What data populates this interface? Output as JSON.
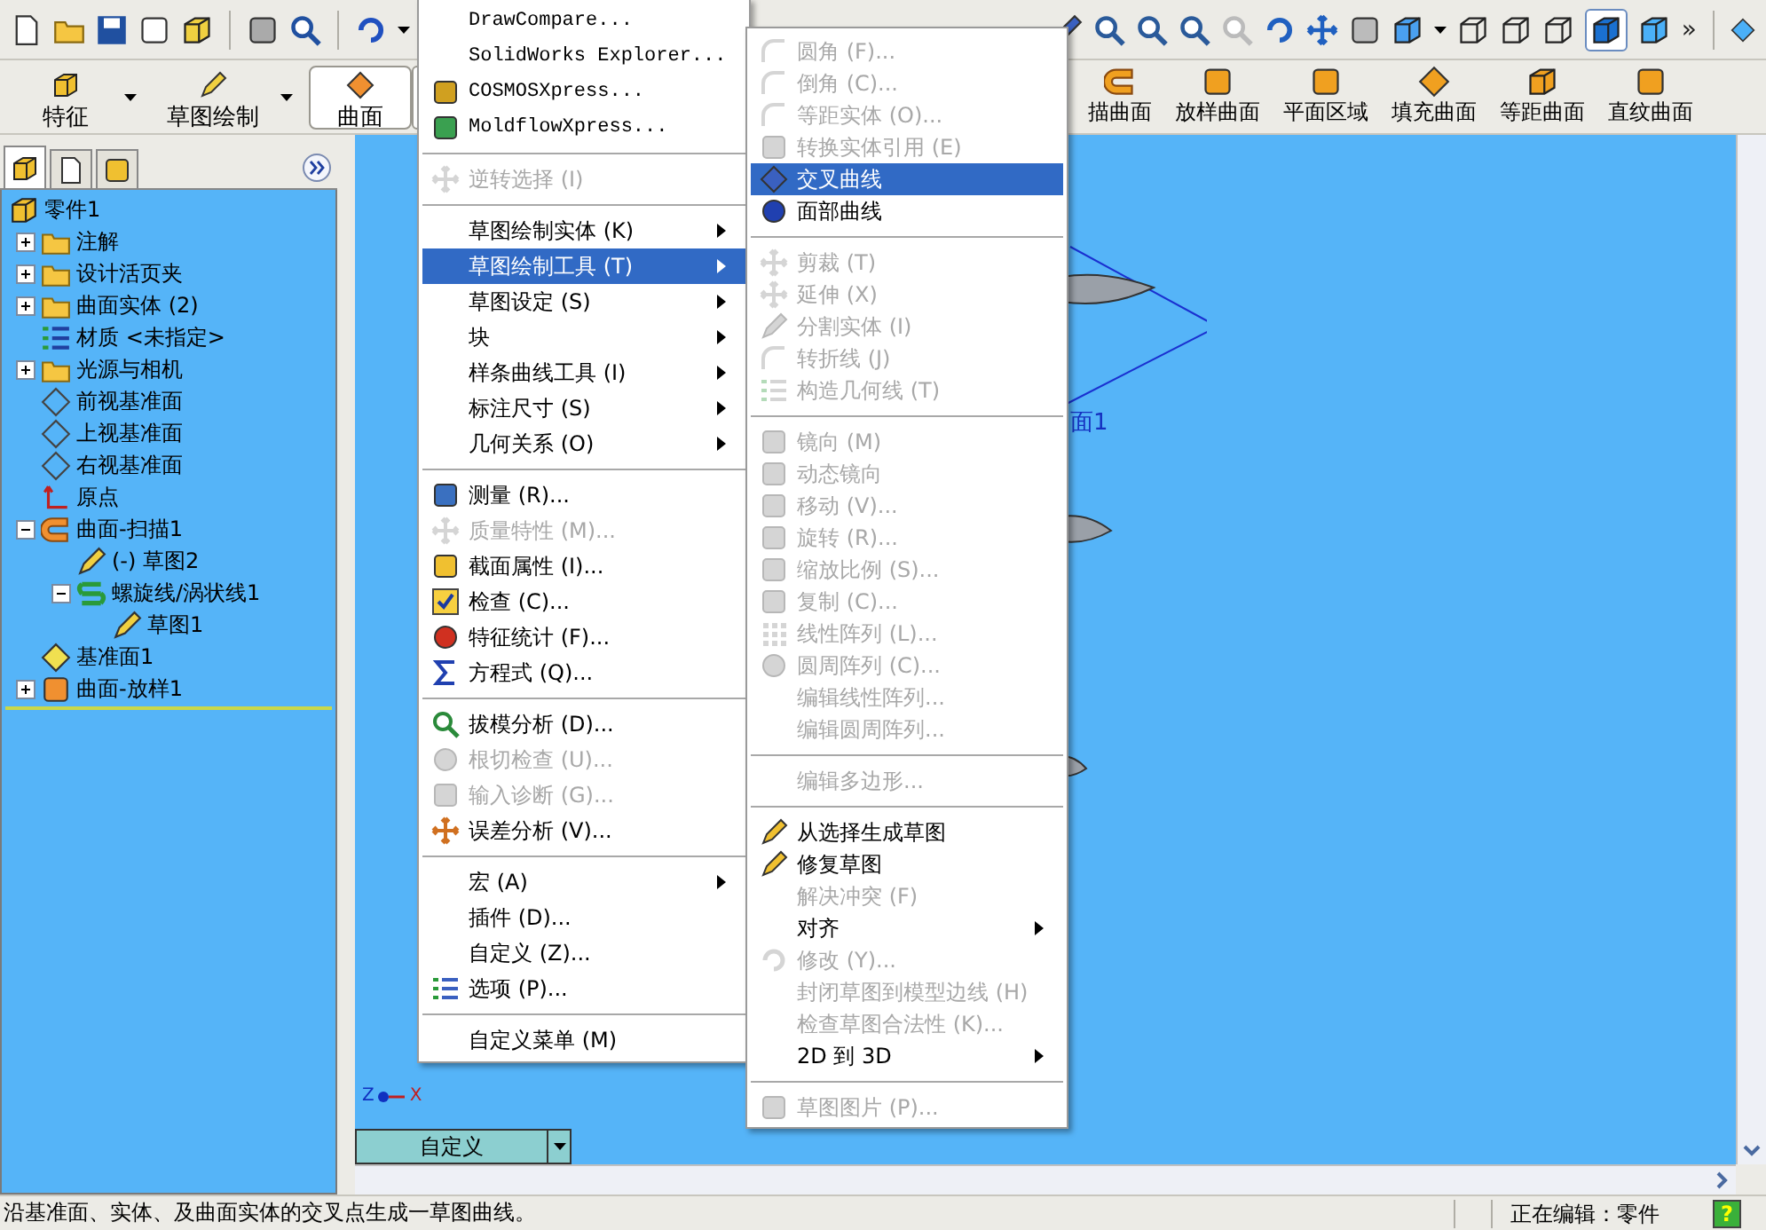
{
  "toolbar": {
    "overflow": "»"
  },
  "command_manager": {
    "tabs": [
      {
        "label": "特征",
        "selected": false
      },
      {
        "label": "草图绘制",
        "selected": false
      },
      {
        "label": "曲面",
        "selected": true
      }
    ],
    "tools": [
      {
        "label": "描曲面"
      },
      {
        "label": "放样曲面"
      },
      {
        "label": "平面区域"
      },
      {
        "label": "填充曲面"
      },
      {
        "label": "等距曲面"
      },
      {
        "label": "直纹曲面"
      }
    ]
  },
  "feature_manager": {
    "tabs": [
      {
        "selected": true
      },
      {
        "selected": false
      },
      {
        "selected": false
      }
    ],
    "tree": {
      "label": "零件1",
      "children": [
        {
          "label": "注解",
          "expanded": false
        },
        {
          "label": "设计活页夹",
          "expanded": false
        },
        {
          "label": "曲面实体 (2)",
          "expanded": false
        },
        {
          "label": "材质 <未指定>"
        },
        {
          "label": "光源与相机",
          "expanded": false
        },
        {
          "label": "前视基准面"
        },
        {
          "label": "上视基准面"
        },
        {
          "label": "右视基准面"
        },
        {
          "label": "原点"
        },
        {
          "label": "曲面-扫描1",
          "expanded": true,
          "children": [
            {
              "label": "(-) 草图2"
            },
            {
              "label": "螺旋线/涡状线1",
              "expanded": true,
              "children": [
                {
                  "label": "草图1"
                }
              ]
            }
          ]
        },
        {
          "label": "基准面1"
        },
        {
          "label": "曲面-放样1",
          "expanded": false
        }
      ]
    }
  },
  "viewport": {
    "plane_label": "面1",
    "axis_labels": [
      "Z",
      "X"
    ],
    "view_selector": "自定义"
  },
  "menu": {
    "items": [
      {
        "kind": "item",
        "label": "DrawCompare...",
        "disabled": false,
        "selected": false,
        "submenu": false
      },
      {
        "kind": "item",
        "label": "SolidWorks Explorer...",
        "disabled": false,
        "selected": false,
        "submenu": false
      },
      {
        "kind": "item",
        "label": "COSMOSXpress...",
        "disabled": false,
        "selected": false,
        "submenu": false
      },
      {
        "kind": "item",
        "label": "MoldflowXpress...",
        "disabled": false,
        "selected": false,
        "submenu": false
      },
      {
        "kind": "separator"
      },
      {
        "kind": "item",
        "label": "逆转选择 (I)",
        "disabled": true,
        "selected": false,
        "submenu": false
      },
      {
        "kind": "separator"
      },
      {
        "kind": "item",
        "label": "草图绘制实体 (K)",
        "disabled": false,
        "selected": false,
        "submenu": true
      },
      {
        "kind": "item",
        "label": "草图绘制工具 (T)",
        "disabled": false,
        "selected": true,
        "submenu": true
      },
      {
        "kind": "item",
        "label": "草图设定 (S)",
        "disabled": false,
        "selected": false,
        "submenu": true
      },
      {
        "kind": "item",
        "label": "块",
        "disabled": false,
        "selected": false,
        "submenu": true
      },
      {
        "kind": "item",
        "label": "样条曲线工具 (I)",
        "disabled": false,
        "selected": false,
        "submenu": true
      },
      {
        "kind": "item",
        "label": "标注尺寸 (S)",
        "disabled": false,
        "selected": false,
        "submenu": true
      },
      {
        "kind": "item",
        "label": "几何关系 (O)",
        "disabled": false,
        "selected": false,
        "submenu": true
      },
      {
        "kind": "separator"
      },
      {
        "kind": "item",
        "label": "测量 (R)...",
        "disabled": false,
        "selected": false,
        "submenu": false
      },
      {
        "kind": "item",
        "label": "质量特性 (M)...",
        "disabled": true,
        "selected": false,
        "submenu": false
      },
      {
        "kind": "item",
        "label": "截面属性 (I)...",
        "disabled": false,
        "selected": false,
        "submenu": false
      },
      {
        "kind": "item",
        "label": "检查 (C)...",
        "disabled": false,
        "selected": false,
        "submenu": false
      },
      {
        "kind": "item",
        "label": "特征统计 (F)...",
        "disabled": false,
        "selected": false,
        "submenu": false
      },
      {
        "kind": "item",
        "label": "方程式 (Q)...",
        "disabled": false,
        "selected": false,
        "submenu": false
      },
      {
        "kind": "separator"
      },
      {
        "kind": "item",
        "label": "拔模分析 (D)...",
        "disabled": false,
        "selected": false,
        "submenu": false
      },
      {
        "kind": "item",
        "label": "根切检查 (U)...",
        "disabled": true,
        "selected": false,
        "submenu": false
      },
      {
        "kind": "item",
        "label": "输入诊断 (G)...",
        "disabled": true,
        "selected": false,
        "submenu": false
      },
      {
        "kind": "item",
        "label": "误差分析 (V)...",
        "disabled": false,
        "selected": false,
        "submenu": false
      },
      {
        "kind": "separator"
      },
      {
        "kind": "item",
        "label": "宏 (A)",
        "disabled": false,
        "selected": false,
        "submenu": true
      },
      {
        "kind": "item",
        "label": "插件 (D)...",
        "disabled": false,
        "selected": false,
        "submenu": false
      },
      {
        "kind": "item",
        "label": "自定义 (Z)...",
        "disabled": false,
        "selected": false,
        "submenu": false
      },
      {
        "kind": "item",
        "label": "选项 (P)...",
        "disabled": false,
        "selected": false,
        "submenu": false
      },
      {
        "kind": "separator"
      },
      {
        "kind": "item",
        "label": "自定义菜单 (M)",
        "disabled": false,
        "selected": false,
        "submenu": false
      }
    ]
  },
  "submenu": {
    "items": [
      {
        "kind": "item",
        "label": "圆角 (F)...",
        "disabled": true,
        "selected": false,
        "submenu": false
      },
      {
        "kind": "item",
        "label": "倒角 (C)...",
        "disabled": true,
        "selected": false,
        "submenu": false
      },
      {
        "kind": "item",
        "label": "等距实体 (O)...",
        "disabled": true,
        "selected": false,
        "submenu": false
      },
      {
        "kind": "item",
        "label": "转换实体引用 (E)",
        "disabled": true,
        "selected": false,
        "submenu": false
      },
      {
        "kind": "item",
        "label": "交叉曲线",
        "disabled": false,
        "selected": true,
        "submenu": false
      },
      {
        "kind": "item",
        "label": "面部曲线",
        "disabled": false,
        "selected": false,
        "submenu": false
      },
      {
        "kind": "separator"
      },
      {
        "kind": "item",
        "label": "剪裁 (T)",
        "disabled": true,
        "selected": false,
        "submenu": false
      },
      {
        "kind": "item",
        "label": "延伸 (X)",
        "disabled": true,
        "selected": false,
        "submenu": false
      },
      {
        "kind": "item",
        "label": "分割实体 (I)",
        "disabled": true,
        "selected": false,
        "submenu": false
      },
      {
        "kind": "item",
        "label": "转折线 (J)",
        "disabled": true,
        "selected": false,
        "submenu": false
      },
      {
        "kind": "item",
        "label": "构造几何线 (T)",
        "disabled": true,
        "selected": false,
        "submenu": false
      },
      {
        "kind": "separator"
      },
      {
        "kind": "item",
        "label": "镜向 (M)",
        "disabled": true,
        "selected": false,
        "submenu": false
      },
      {
        "kind": "item",
        "label": "动态镜向",
        "disabled": true,
        "selected": false,
        "submenu": false
      },
      {
        "kind": "item",
        "label": "移动 (V)...",
        "disabled": true,
        "selected": false,
        "submenu": false
      },
      {
        "kind": "item",
        "label": "旋转 (R)...",
        "disabled": true,
        "selected": false,
        "submenu": false
      },
      {
        "kind": "item",
        "label": "缩放比例 (S)...",
        "disabled": true,
        "selected": false,
        "submenu": false
      },
      {
        "kind": "item",
        "label": "复制 (C)...",
        "disabled": true,
        "selected": false,
        "submenu": false
      },
      {
        "kind": "item",
        "label": "线性阵列 (L)...",
        "disabled": true,
        "selected": false,
        "submenu": false
      },
      {
        "kind": "item",
        "label": "圆周阵列 (C)...",
        "disabled": true,
        "selected": false,
        "submenu": false
      },
      {
        "kind": "item",
        "label": "编辑线性阵列...",
        "disabled": true,
        "selected": false,
        "submenu": false
      },
      {
        "kind": "item",
        "label": "编辑圆周阵列...",
        "disabled": true,
        "selected": false,
        "submenu": false
      },
      {
        "kind": "separator"
      },
      {
        "kind": "item",
        "label": "编辑多边形...",
        "disabled": true,
        "selected": false,
        "submenu": false
      },
      {
        "kind": "separator"
      },
      {
        "kind": "item",
        "label": "从选择生成草图",
        "disabled": false,
        "selected": false,
        "submenu": false
      },
      {
        "kind": "item",
        "label": "修复草图",
        "disabled": false,
        "selected": false,
        "submenu": false
      },
      {
        "kind": "item",
        "label": "解决冲突 (F)",
        "disabled": true,
        "selected": false,
        "submenu": false
      },
      {
        "kind": "item",
        "label": "对齐",
        "disabled": false,
        "selected": false,
        "submenu": true
      },
      {
        "kind": "item",
        "label": "修改 (Y)...",
        "disabled": true,
        "selected": false,
        "submenu": false
      },
      {
        "kind": "item",
        "label": "封闭草图到模型边线 (H)",
        "disabled": true,
        "selected": false,
        "submenu": false
      },
      {
        "kind": "item",
        "label": "检查草图合法性 (K)...",
        "disabled": true,
        "selected": false,
        "submenu": false
      },
      {
        "kind": "item",
        "label": "2D 到 3D",
        "disabled": false,
        "selected": false,
        "submenu": true
      },
      {
        "kind": "separator"
      },
      {
        "kind": "item",
        "label": "草图图片 (P)...",
        "disabled": true,
        "selected": false,
        "submenu": false
      }
    ]
  },
  "status_bar": {
    "message": "沿基准面、实体、及曲面实体的交叉点生成一草图曲线。",
    "mode": "正在编辑：零件",
    "help": "?"
  }
}
